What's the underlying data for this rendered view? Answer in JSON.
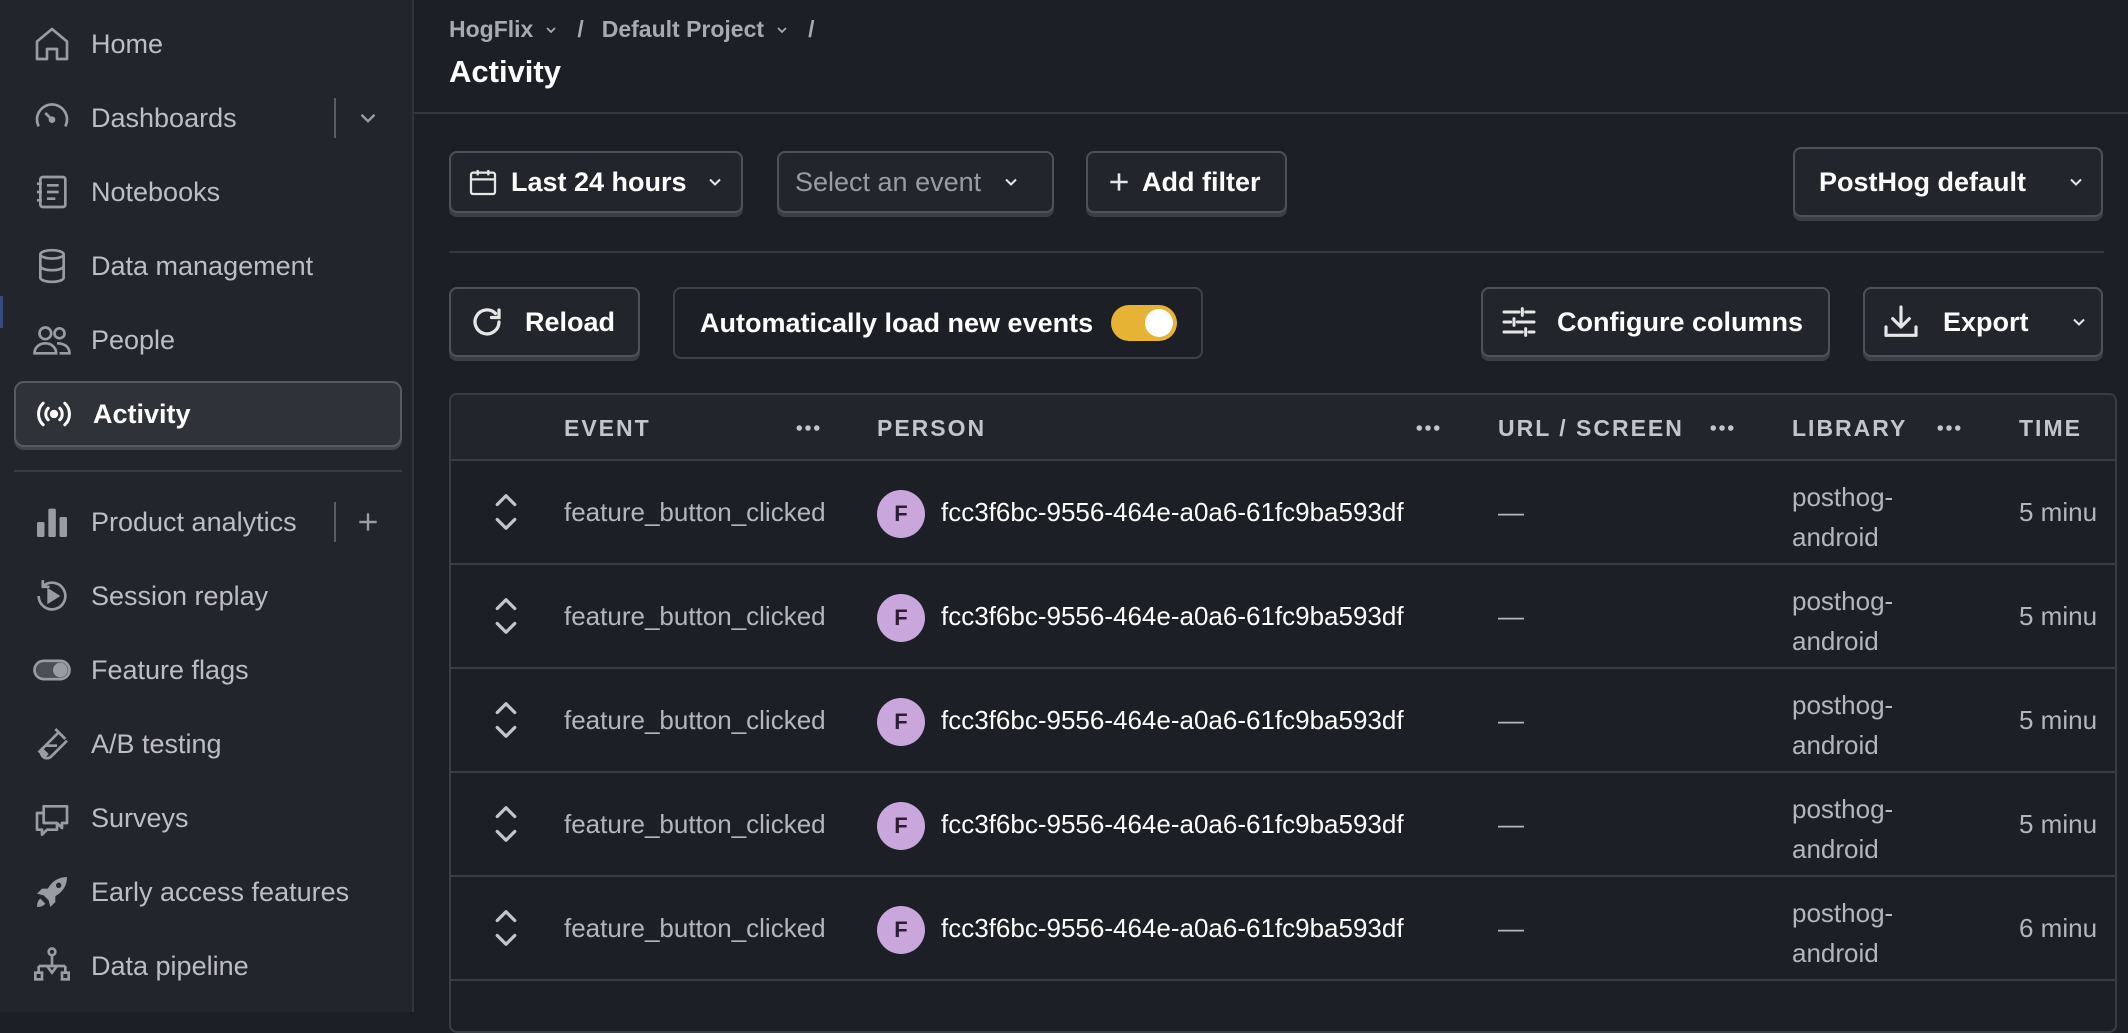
{
  "sidebar": {
    "items": [
      {
        "label": "Home",
        "icon": "home-icon"
      },
      {
        "label": "Dashboards",
        "icon": "dashboard-gauge-icon"
      },
      {
        "label": "Notebooks",
        "icon": "notebook-icon"
      },
      {
        "label": "Data management",
        "icon": "database-icon"
      },
      {
        "label": "People",
        "icon": "people-icon"
      },
      {
        "label": "Activity",
        "icon": "activity-broadcast-icon",
        "active": true
      },
      {
        "label": "Product analytics",
        "icon": "bar-chart-icon"
      },
      {
        "label": "Session replay",
        "icon": "replay-icon"
      },
      {
        "label": "Feature flags",
        "icon": "toggle-icon"
      },
      {
        "label": "A/B testing",
        "icon": "flask-icon"
      },
      {
        "label": "Surveys",
        "icon": "chat-bubbles-icon"
      },
      {
        "label": "Early access features",
        "icon": "rocket-icon"
      },
      {
        "label": "Data pipeline",
        "icon": "pipeline-icon"
      }
    ]
  },
  "breadcrumb": {
    "org": "HogFlix",
    "project": "Default Project",
    "separator": "/"
  },
  "page": {
    "title": "Activity"
  },
  "toolbar": {
    "date_range": "Last 24 hours",
    "event_select_placeholder": "Select an event",
    "add_filter": "Add filter",
    "test_account_filter": "PostHog default",
    "reload": "Reload",
    "auto_load_label": "Automatically load new events",
    "auto_load_enabled": true,
    "configure_columns": "Configure columns",
    "export": "Export"
  },
  "table": {
    "columns": [
      "EVENT",
      "PERSON",
      "URL / SCREEN",
      "LIBRARY",
      "TIME"
    ],
    "rows": [
      {
        "event": "feature_button_clicked",
        "avatar": "F",
        "person": "fcc3f6bc-9556-464e-a0a6-61fc9ba593df",
        "url": "—",
        "library_line1": "posthog-",
        "library_line2": "android",
        "time": "5 minu"
      },
      {
        "event": "feature_button_clicked",
        "avatar": "F",
        "person": "fcc3f6bc-9556-464e-a0a6-61fc9ba593df",
        "url": "—",
        "library_line1": "posthog-",
        "library_line2": "android",
        "time": "5 minu"
      },
      {
        "event": "feature_button_clicked",
        "avatar": "F",
        "person": "fcc3f6bc-9556-464e-a0a6-61fc9ba593df",
        "url": "—",
        "library_line1": "posthog-",
        "library_line2": "android",
        "time": "5 minu"
      },
      {
        "event": "feature_button_clicked",
        "avatar": "F",
        "person": "fcc3f6bc-9556-464e-a0a6-61fc9ba593df",
        "url": "—",
        "library_line1": "posthog-",
        "library_line2": "android",
        "time": "5 minu"
      },
      {
        "event": "feature_button_clicked",
        "avatar": "F",
        "person": "fcc3f6bc-9556-464e-a0a6-61fc9ba593df",
        "url": "—",
        "library_line1": "posthog-",
        "library_line2": "android",
        "time": "6 minu"
      }
    ]
  },
  "colors": {
    "background": "#1d1f27",
    "sidebar": "#23252d",
    "toggle_on": "#e6b335",
    "avatar": "#c9a7dd"
  }
}
